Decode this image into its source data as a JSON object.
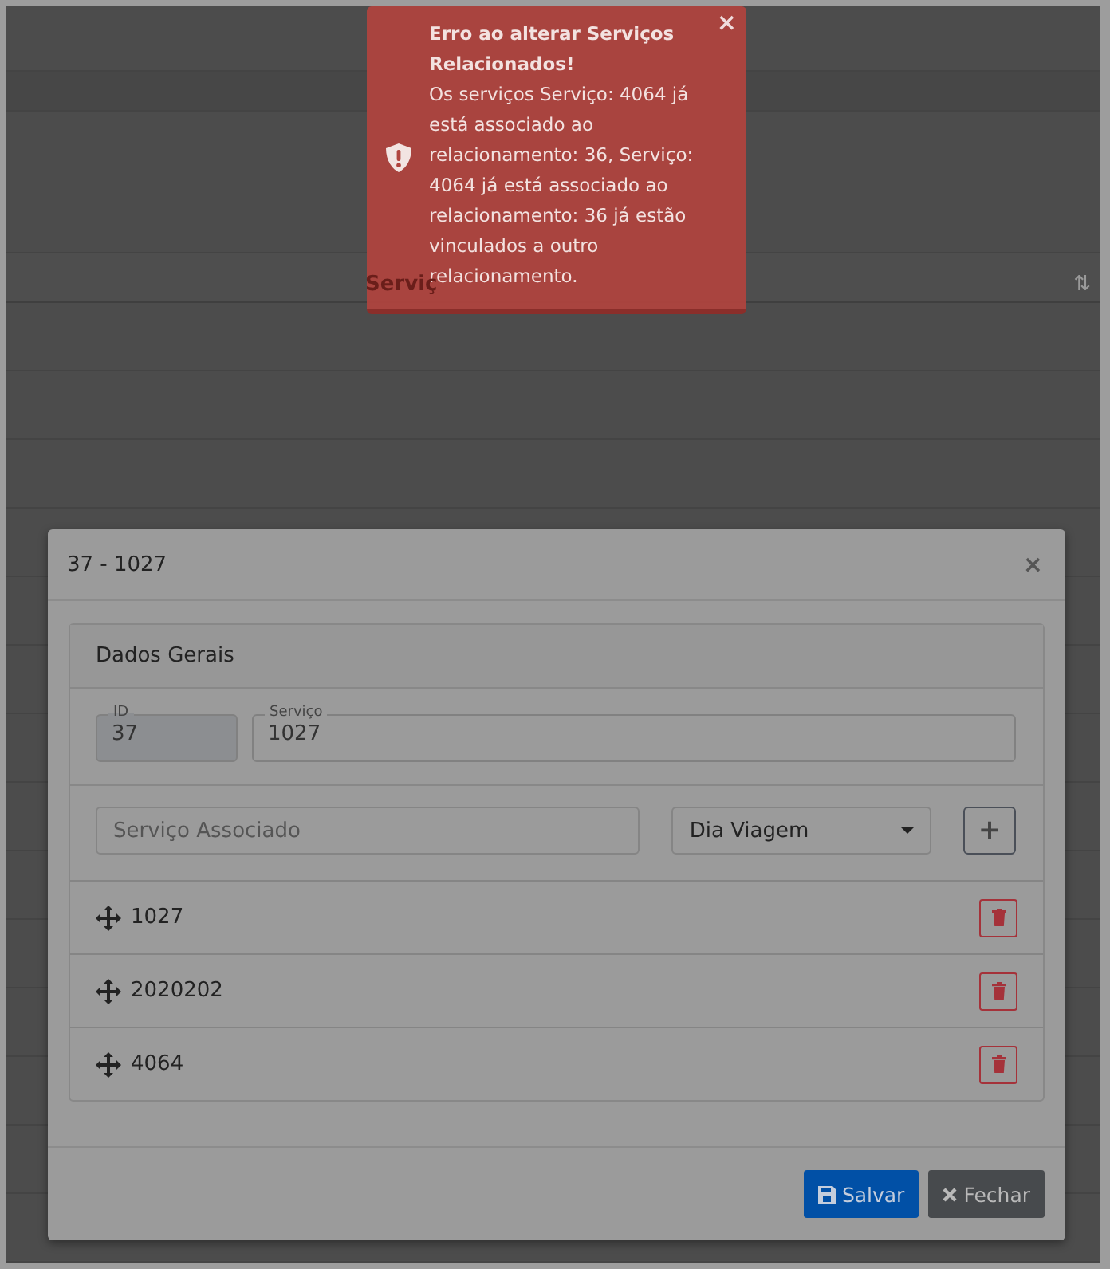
{
  "background_table": {
    "column_header": "Serviç",
    "sort": "⇅"
  },
  "toast": {
    "title": "Erro ao alterar Serviços Relacionados!",
    "message": "Os serviços Serviço: 4064 já está associado ao relacionamento: 36, Serviço: 4064 já está associado ao relacionamento: 36 já estão vinculados a outro relacionamento.",
    "close": "×"
  },
  "modal": {
    "title": "37 - 1027",
    "close": "×",
    "panel": {
      "title": "Dados Gerais",
      "id_field": {
        "label": "ID",
        "value": "37",
        "disabled": true
      },
      "service_field": {
        "label": "Serviço",
        "value": "1027",
        "disabled": false
      },
      "associated_field": {
        "placeholder": "Serviço Associado"
      },
      "day_select": {
        "value": "Dia Viagem"
      },
      "add_button": "+",
      "items": [
        {
          "label": "1027"
        },
        {
          "label": "2020202"
        },
        {
          "label": "4064"
        }
      ]
    },
    "buttons": [
      {
        "label": "Salvar",
        "kind": "primary"
      },
      {
        "label": "Fechar",
        "kind": "secondary"
      }
    ]
  }
}
